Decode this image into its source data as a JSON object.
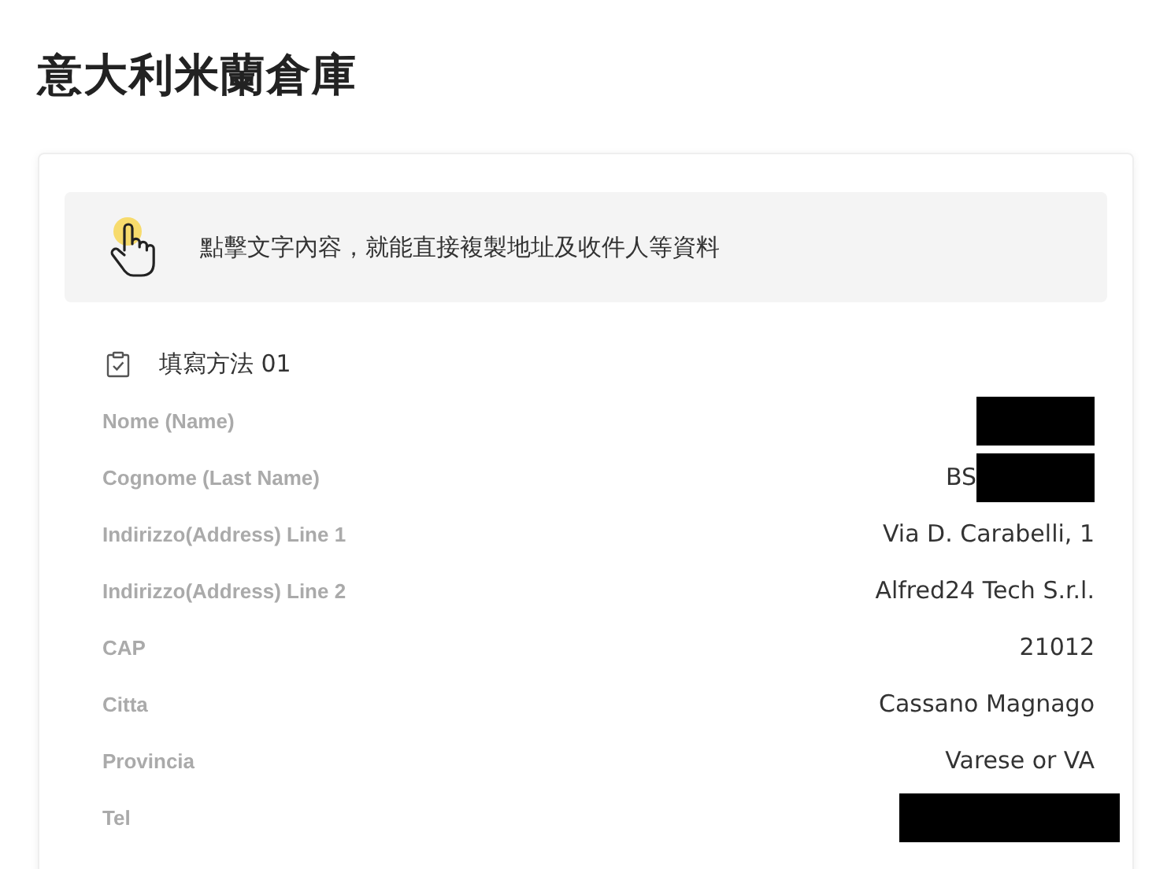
{
  "page_title": "意大利米蘭倉庫",
  "notice": {
    "text": "點擊文字內容，就能直接複製地址及收件人等資料"
  },
  "section": {
    "title": "填寫方法 01"
  },
  "rows": [
    {
      "label": "Nome (Name)",
      "redacted": true
    },
    {
      "label": "Cognome (Last Name)",
      "value": "BS",
      "redacted": true
    },
    {
      "label": "Indirizzo(Address) Line 1",
      "value": "Via D. Carabelli, 1",
      "redacted": false
    },
    {
      "label": "Indirizzo(Address) Line 2",
      "value": "Alfred24 Tech S.r.l.",
      "redacted": false
    },
    {
      "label": "CAP",
      "value": "21012",
      "redacted": false
    },
    {
      "label": "Citta",
      "value": "Cassano Magnago",
      "redacted": false
    },
    {
      "label": "Provincia",
      "value": "Varese or VA",
      "redacted": false
    },
    {
      "label": "Tel",
      "redacted": true,
      "wide": true
    }
  ]
}
